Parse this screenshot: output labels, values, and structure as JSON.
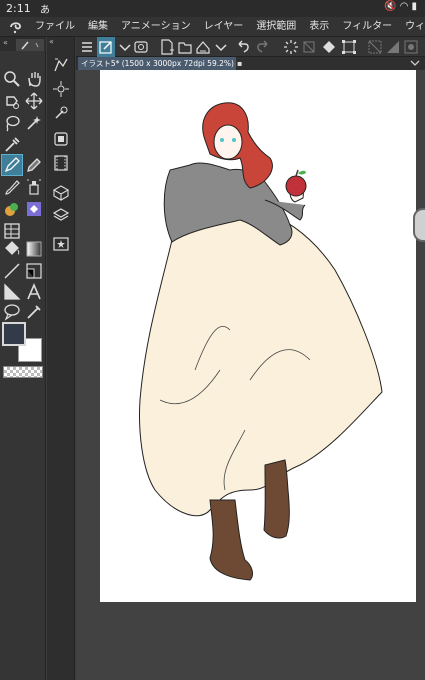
{
  "statusbar": {
    "time": "2:11",
    "notification": "あ",
    "icons": [
      "mute-icon",
      "wifi-icon",
      "battery-icon"
    ]
  },
  "menubar": {
    "items": [
      "ファイル",
      "編集",
      "アニメーション",
      "レイヤー",
      "選択範囲",
      "表示",
      "フィルター",
      "ウィンドウ"
    ]
  },
  "document": {
    "tab_label": "イラスト5* (1500 x 3000px 72dpi 59.2%)",
    "close_mark": "▪"
  },
  "colors": {
    "main_color": "#333a48",
    "sub_color": "#ffffff",
    "active_tool": "#3f7f9a",
    "sweater": "#8a8a8a",
    "skirt": "#faf0dc",
    "hair": "#c9453a",
    "boots": "#6e4a35",
    "apple": "#c0313a"
  },
  "left_tools": [
    "zoom-icon",
    "hand-icon",
    "rotate-icon",
    "move-icon",
    "lasso-select-icon",
    "auto-select-icon",
    "eyedropper-icon",
    "pen-icon",
    "pencil-icon",
    "brush-icon",
    "airbrush-icon",
    "decoration-icon",
    "eraser-icon",
    "blend-icon",
    "frame-border-icon",
    "fill-icon",
    "gradient-icon",
    "line-icon",
    "ruler-icon",
    "figure-icon",
    "text-icon",
    "balloon-icon",
    "correct-line-icon"
  ],
  "sub_tools": [
    "shape-icon",
    "transform-icon",
    "settings-icon",
    "layer-icon",
    "filmstrip-icon",
    "3d-icon",
    "layers-icon",
    "material-icon"
  ]
}
